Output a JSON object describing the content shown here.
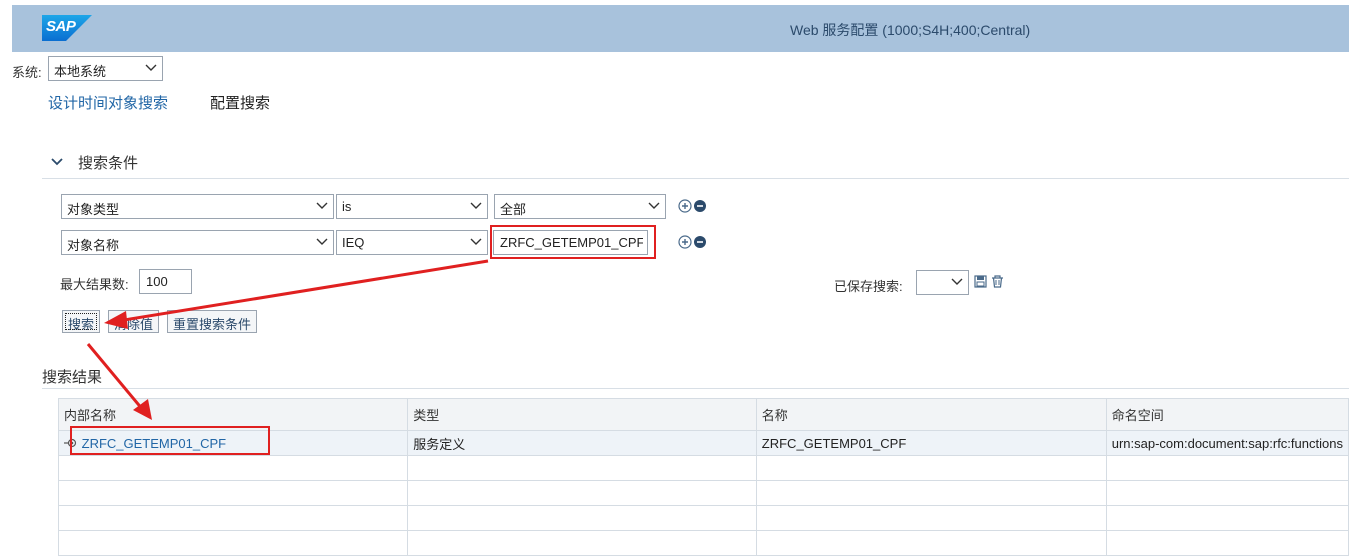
{
  "header": {
    "logo": "SAP",
    "title": "Web 服务配置 (1000;S4H;400;Central)"
  },
  "system": {
    "label": "系统:",
    "value": "本地系统"
  },
  "tabs": [
    {
      "label": "设计时间对象搜索",
      "active": true
    },
    {
      "label": "配置搜索",
      "active": false
    }
  ],
  "search": {
    "section_title": "搜索条件",
    "rows": [
      {
        "field": "对象类型",
        "operator": "is",
        "value": "全部"
      },
      {
        "field": "对象名称",
        "operator": "IEQ",
        "value": "ZRFC_GETEMP01_CPF"
      }
    ],
    "max_results_label": "最大结果数:",
    "max_results_value": "100",
    "saved_search_label": "已保存搜索:",
    "saved_search_value": "",
    "buttons": {
      "search": "搜索",
      "clear": "清除值",
      "reset": "重置搜索条件"
    }
  },
  "results": {
    "title": "搜索结果",
    "columns": [
      "内部名称",
      "类型",
      "名称",
      "命名空间"
    ],
    "rows": [
      {
        "internal_name": "ZRFC_GETEMP01_CPF",
        "type": "服务定义",
        "name": "ZRFC_GETEMP01_CPF",
        "namespace": "urn:sap-com:document:sap:rfc:functions"
      }
    ]
  },
  "colors": {
    "header_bg": "#a8c2dc",
    "accent": "#2166a6",
    "annotation": "#e02020"
  }
}
